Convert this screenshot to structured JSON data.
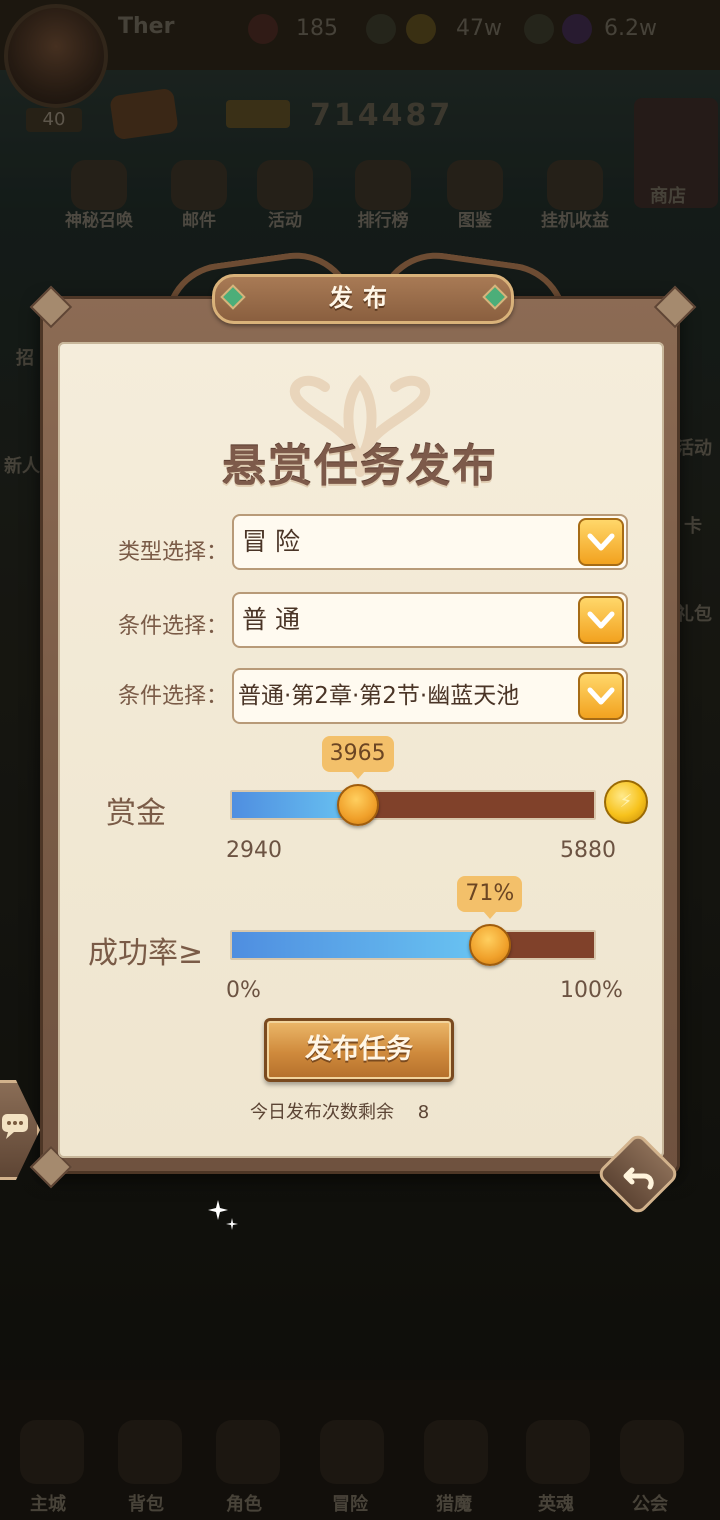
{
  "background": {
    "player_name": "Ther",
    "player_level": "40",
    "hearts": "185",
    "gold": "47w",
    "gems": "6.2w",
    "power": "714487",
    "menu": [
      "神秘召唤",
      "邮件",
      "活动",
      "排行榜",
      "图鉴",
      "挂机收益"
    ],
    "shop_label": "商店",
    "side_labels": [
      "招",
      "新人",
      "活动",
      "卡",
      "礼包"
    ],
    "tabs": [
      "主城",
      "背包",
      "角色",
      "冒险",
      "猎魔",
      "英魂",
      "公会"
    ]
  },
  "dialog": {
    "header": "发布",
    "title": "悬赏任务发布",
    "type_label": "类型选择：",
    "type_value": "冒 险",
    "condition_label_1": "条件选择：",
    "condition_value_1": "普 通",
    "condition_label_2": "条件选择：",
    "condition_value_2": "普通·第2章·第2节·幽蓝天池",
    "reward": {
      "label": "赏金",
      "value": 3965,
      "value_text": "3965",
      "min_text": "2940",
      "max_text": "5880",
      "min": 2940,
      "max": 5880
    },
    "success": {
      "label": "成功率≥",
      "value": 71,
      "value_text": "71%",
      "min_text": "0%",
      "max_text": "100%",
      "min": 0,
      "max": 100
    },
    "publish_button": "发布任务",
    "remaining_label": "今日发布次数剩余",
    "remaining_count": "8"
  },
  "colors": {
    "frame": "#7a5c47",
    "paper": "#f3ebd8",
    "track_empty": "#80412a",
    "track_fill": "#6ac5f2",
    "knob": "#f0a02a"
  },
  "icons": [
    "heart-icon",
    "plus-icon",
    "coin-icon",
    "gem-icon",
    "chevron-down-icon",
    "gold-coin-icon",
    "back-icon",
    "chat-icon",
    "sparkle-icon"
  ]
}
